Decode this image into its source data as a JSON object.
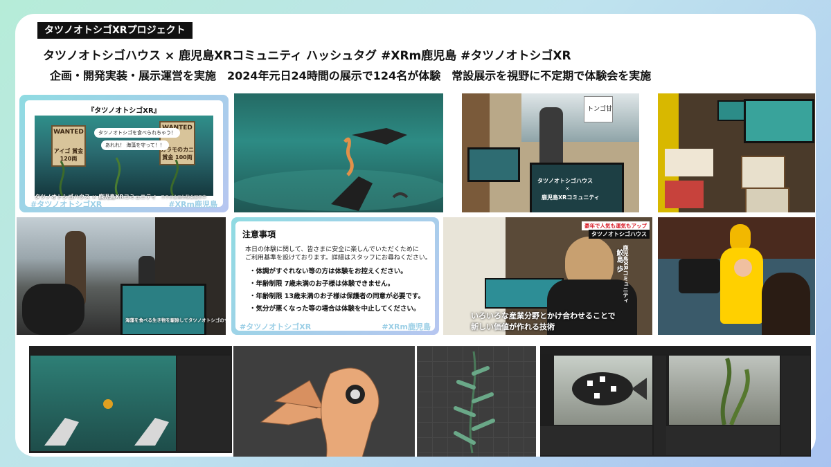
{
  "header": {
    "tag": "タツノオトシゴXRプロジェクト",
    "line1": "タツノオトシゴハウス × 鹿児島XRコミュニティ ハッシュタグ #XRm鹿児島 #タツノオトシゴXR",
    "line2": "企画・開発実装・展示運営を実施　2024年元日24時間の展示で124名が体験　常設展示を視野に不定期で体験会を実施"
  },
  "poster": {
    "title": "『タツノオトシゴXR』",
    "wanted_left": "WANTED",
    "price_left": "アイゴ 賞金 120両",
    "wanted_right": "WANTED",
    "price_right": "ガラモのカニ 賞金 100両",
    "bubble1": "タツノオトシゴを食べられちゃう！",
    "bubble2": "あれれ！ 海藻を守って！！",
    "footer": "タツノオトシゴハウス × 鹿児島XRコミュニティ",
    "footer_small": "コラボ企画体験会展示中",
    "wm_left": "#タツノオトシゴXR",
    "wm_right": "#XRm鹿児島"
  },
  "tv_caption": {
    "line1": "タツノオトシゴハウス",
    "line2": "×",
    "line3": "鹿児島XRコミュニティ"
  },
  "sign_text": "トンゴ甘",
  "notice": {
    "title": "注意事項",
    "intro1": "本日の体験に関して、皆さまに安全に楽しんでいただくために",
    "intro2": "ご利用基準を設けております。詳細はスタッフにお尋ねください。",
    "items": [
      "・体調がすぐれない等の方は体験をお控えください。",
      "・年齢制限 7歳未満のお子様は体験できません。",
      "・年齢制限 13歳未満のお子様は保護者の同意が必要です。",
      "・気分が悪くなった等の場合は体験を中止してください。"
    ],
    "wm_left": "#タツノオトシゴXR",
    "wm_right": "#XRm鹿児島"
  },
  "panel_caption": "海藻を食べる生き物を駆除してタツノオトシゴのすみかを守ろう",
  "interview": {
    "banner1": "豪年で人気も運気もアップ",
    "banner2": "タツノオトシゴハウス",
    "name": "鮫島 歩",
    "role": "鹿児島XRコミュニティ",
    "sub1": "いろいろな産業分野とかけ合わせることで",
    "sub2": "新しい価値が作れる技術"
  },
  "colors": {
    "accent_red": "#d8202a",
    "tag_bg": "#111111",
    "watermark": "#9ccfe6"
  }
}
